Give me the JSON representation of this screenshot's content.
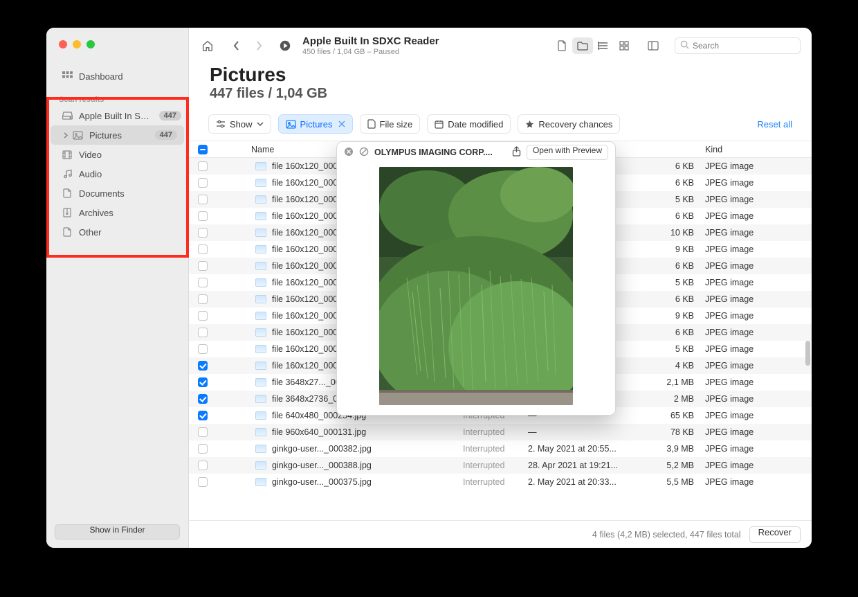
{
  "sidebar": {
    "dashboard": "Dashboard",
    "section_label": "Scan results",
    "items": [
      {
        "label": "Apple Built In SD...",
        "badge": "447",
        "icon": "drive",
        "arrow": false
      },
      {
        "label": "Pictures",
        "badge": "447",
        "icon": "image",
        "arrow": true,
        "active": true
      },
      {
        "label": "Video",
        "icon": "film"
      },
      {
        "label": "Audio",
        "icon": "music"
      },
      {
        "label": "Documents",
        "icon": "doc"
      },
      {
        "label": "Archives",
        "icon": "archive"
      },
      {
        "label": "Other",
        "icon": "doc"
      }
    ],
    "footer_button": "Show in Finder"
  },
  "toolbar": {
    "title": "Apple Built In SDXC Reader",
    "subtitle": "450 files / 1,04 GB – Paused",
    "search_placeholder": "Search"
  },
  "header": {
    "title": "Pictures",
    "subtitle": "447 files / 1,04 GB"
  },
  "filters": {
    "show": "Show",
    "pictures": "Pictures",
    "filesize": "File size",
    "date": "Date modified",
    "recovery": "Recovery chances",
    "reset": "Reset all"
  },
  "columns": {
    "name": "Name",
    "kind": "Kind"
  },
  "rows": [
    {
      "chk": false,
      "name": "file 160x120_00026",
      "size": "6 KB",
      "kind": "JPEG image"
    },
    {
      "chk": false,
      "name": "file 160x120_00027",
      "size": "6 KB",
      "kind": "JPEG image"
    },
    {
      "chk": false,
      "name": "file 160x120_00028",
      "size": "5 KB",
      "kind": "JPEG image"
    },
    {
      "chk": false,
      "name": "file 160x120_00028",
      "size": "6 KB",
      "kind": "JPEG image"
    },
    {
      "chk": false,
      "name": "file 160x120_00029",
      "size": "10 KB",
      "kind": "JPEG image"
    },
    {
      "chk": false,
      "name": "file 160x120_00034",
      "size": "9 KB",
      "kind": "JPEG image"
    },
    {
      "chk": false,
      "name": "file 160x120_00034",
      "size": "6 KB",
      "kind": "JPEG image"
    },
    {
      "chk": false,
      "name": "file 160x120_00035",
      "size": "5 KB",
      "kind": "JPEG image"
    },
    {
      "chk": false,
      "name": "file 160x120_00036",
      "size": "6 KB",
      "kind": "JPEG image"
    },
    {
      "chk": false,
      "name": "file 160x120_00036",
      "size": "9 KB",
      "kind": "JPEG image"
    },
    {
      "chk": false,
      "name": "file 160x120_00036",
      "size": "6 KB",
      "kind": "JPEG image"
    },
    {
      "chk": false,
      "name": "file 160x120_00037",
      "size": "5 KB",
      "kind": "JPEG image"
    },
    {
      "chk": true,
      "name": "file 160x120_00037",
      "size": "4 KB",
      "kind": "JPEG image"
    },
    {
      "chk": true,
      "name": "file 3648x27..._00",
      "size": "2,1 MB",
      "kind": "JPEG image"
    },
    {
      "chk": true,
      "name": "file 3648x2736_00",
      "size": "2 MB",
      "kind": "JPEG image"
    },
    {
      "chk": true,
      "name": "file 640x480_000254.jpg",
      "status": "Interrupted",
      "date": "—",
      "size": "65 KB",
      "kind": "JPEG image"
    },
    {
      "chk": false,
      "name": "file 960x640_000131.jpg",
      "status": "Interrupted",
      "date": "—",
      "size": "78 KB",
      "kind": "JPEG image"
    },
    {
      "chk": false,
      "name": "ginkgo-user..._000382.jpg",
      "status": "Interrupted",
      "date": "2. May 2021 at 20:55...",
      "size": "3,9 MB",
      "kind": "JPEG image"
    },
    {
      "chk": false,
      "name": "ginkgo-user..._000388.jpg",
      "status": "Interrupted",
      "date": "28. Apr 2021 at 19:21...",
      "size": "5,2 MB",
      "kind": "JPEG image"
    },
    {
      "chk": false,
      "name": "ginkgo-user..._000375.jpg",
      "status": "Interrupted",
      "date": "2. May 2021 at 20:33...",
      "size": "5,5 MB",
      "kind": "JPEG image"
    }
  ],
  "preview": {
    "title": "OLYMPUS IMAGING CORP....",
    "open_button": "Open with Preview"
  },
  "footer": {
    "info": "4 files (4,2 MB) selected, 447 files total",
    "recover": "Recover"
  }
}
